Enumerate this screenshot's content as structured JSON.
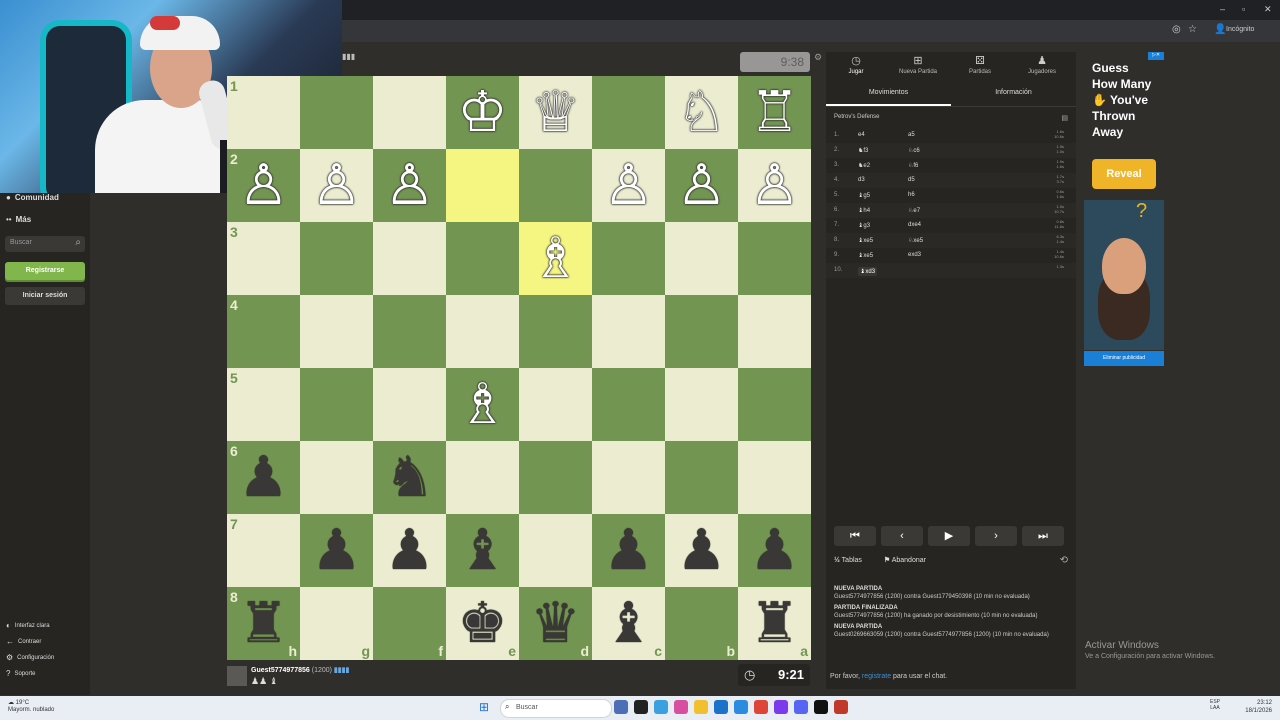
{
  "browser": {
    "incognito_label": "Incógnito",
    "win_min": "–",
    "win_max": "▫",
    "win_close": "✕"
  },
  "sidebar": {
    "community": "Comunidad",
    "more": "Más",
    "search_placeholder": "Buscar",
    "register": "Registrarse",
    "login": "Iniciar sesión",
    "bottom": [
      {
        "icon": "sun-icon",
        "glyph": "◐",
        "label": "Interfaz clara"
      },
      {
        "icon": "collapse-icon",
        "glyph": "←",
        "label": "Contraer"
      },
      {
        "icon": "gear-icon",
        "glyph": "⚙",
        "label": "Configuración"
      },
      {
        "icon": "help-icon",
        "glyph": "?",
        "label": "Soporte"
      }
    ]
  },
  "board": {
    "orientation": "black",
    "top_clock": "9:38",
    "bottom_clock": "9:21",
    "ranks": [
      "1",
      "2",
      "3",
      "4",
      "5",
      "6",
      "7",
      "8"
    ],
    "files": [
      "h",
      "g",
      "f",
      "e",
      "d",
      "c",
      "b",
      "a"
    ],
    "position": [
      [
        "",
        "",
        "",
        "♔",
        "♕",
        "",
        "♘",
        "♖"
      ],
      [
        "♙",
        "♙",
        "♙",
        "",
        "",
        "♙",
        "♙",
        "♙"
      ],
      [
        "",
        "",
        "",
        "",
        "♗",
        "",
        "",
        ""
      ],
      [
        "",
        "",
        "",
        "",
        "",
        "",
        "",
        ""
      ],
      [
        "",
        "",
        "",
        "♗",
        "",
        "",
        "",
        ""
      ],
      [
        "♟",
        "",
        "♞",
        "",
        "",
        "",
        "",
        ""
      ],
      [
        "",
        "♟",
        "♟",
        "♝",
        "",
        "♟",
        "♟",
        "♟"
      ],
      [
        "♜",
        "",
        "",
        "♚",
        "♛",
        "♝",
        "",
        "♜"
      ]
    ],
    "highlight": [
      [
        1,
        3
      ],
      [
        2,
        4
      ]
    ]
  },
  "bottom_player": {
    "name": "Guest5774977856",
    "rating": "(1200)",
    "flag": "▮▮▮▮",
    "captured": "♟♟ ♝"
  },
  "panel": {
    "nav": [
      {
        "icon": "clock-icon",
        "glyph": "◷",
        "label": "Jugar",
        "active": true
      },
      {
        "icon": "plus-icon",
        "glyph": "⊞",
        "label": "Nueva Partida"
      },
      {
        "icon": "dice-icon",
        "glyph": "⚄",
        "label": "Partidas"
      },
      {
        "icon": "players-icon",
        "glyph": "♟",
        "label": "Jugadores"
      }
    ],
    "subtabs": [
      "Movimientos",
      "Información"
    ],
    "opening": "Petrov's Defense",
    "moves": [
      {
        "n": "1.",
        "w": "e4",
        "b": "a5",
        "t": "1.6s\n10.6s"
      },
      {
        "n": "2.",
        "w": "♞f3",
        "b": "♘c6",
        "t": "1.9s\n1.0s"
      },
      {
        "n": "3.",
        "w": "♞e2",
        "b": "♘f6",
        "t": "1.9s\n1.6s"
      },
      {
        "n": "4.",
        "w": "d3",
        "b": "d5",
        "t": "1.7s\n3.7s"
      },
      {
        "n": "5.",
        "w": "♝g5",
        "b": "h6",
        "t": "0.6s\n1.6s"
      },
      {
        "n": "6.",
        "w": "♝h4",
        "b": "♘e7",
        "t": "1.0s\n10.7s"
      },
      {
        "n": "7.",
        "w": "♝g3",
        "b": "dxe4",
        "t": "0.8s\n11.6s"
      },
      {
        "n": "8.",
        "w": "♝xe5",
        "b": "♘xe5",
        "t": "6.3s\n1.4s"
      },
      {
        "n": "9.",
        "w": "♝xe5",
        "b": "exd3",
        "t": "1.4s\n10.6s"
      },
      {
        "n": "10.",
        "w": "♝xd3",
        "b": "",
        "t": "1.3s"
      }
    ],
    "controls": [
      "⏮",
      "‹",
      "▶",
      "›",
      "⏭"
    ],
    "draw": "Tablas",
    "resign": "Abandonar",
    "log": [
      {
        "head": "NUEVA PARTIDA",
        "text": "Guest5774977856 (1200) contra Guest1779450398 (10 min no evaluada)"
      },
      {
        "head": "PARTIDA FINALIZADA",
        "text": "Guest5774977856 (1200) ha ganado por desistimiento (10 min no evaluada)"
      },
      {
        "head": "NUEVA PARTIDA",
        "text": "Guest0269663059 (1200) contra Guest5774977856 (1200) (10 min no evaluada)"
      }
    ],
    "chat_prefix": "Por favor, ",
    "chat_link": "registrate",
    "chat_suffix": " para usar el chat."
  },
  "ad": {
    "title_lines": [
      "Guess",
      "How Many",
      "✋ You've",
      "Thrown",
      "Away"
    ],
    "reveal": "Reveal",
    "remove": "Eliminar publicidad"
  },
  "watermark": {
    "line1": "Activar Windows",
    "line2": "Ve a Configuración para activar Windows."
  },
  "taskbar": {
    "temp": "19°C",
    "weather": "Mayorm. nublado",
    "search": "Buscar",
    "lang1": "ESP",
    "lang2": "LAA",
    "time": "23:12",
    "date": "18/1/2026"
  }
}
